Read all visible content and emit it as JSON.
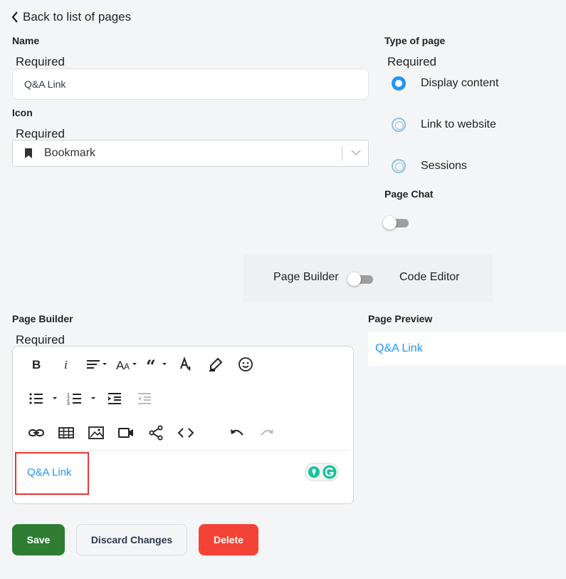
{
  "nav": {
    "back_label": "Back to list of pages"
  },
  "name_field": {
    "label": "Name",
    "required": "Required",
    "value": "Q&A Link"
  },
  "icon_field": {
    "label": "Icon",
    "required": "Required",
    "value": "Bookmark",
    "icon": "bookmark-icon"
  },
  "type_of_page": {
    "label": "Type of page",
    "required": "Required",
    "options": [
      {
        "label": "Display content",
        "selected": true
      },
      {
        "label": "Link to website",
        "selected": false
      },
      {
        "label": "Sessions",
        "selected": false
      }
    ]
  },
  "page_chat": {
    "label": "Page Chat",
    "enabled": false
  },
  "mode_switch": {
    "left_label": "Page Builder",
    "right_label": "Code Editor",
    "code_editor_on": false
  },
  "page_builder": {
    "label": "Page Builder",
    "required": "Required",
    "content": "Q&A Link",
    "toolbar_icons": [
      "bold-icon",
      "italic-icon",
      "align-icon",
      "font-size-icon",
      "quote-icon",
      "text-color-icon",
      "highlight-icon",
      "emoji-icon",
      "bullet-list-icon",
      "numbered-list-icon",
      "indent-icon",
      "outdent-icon",
      "link-icon",
      "table-icon",
      "image-icon",
      "video-icon",
      "share-icon",
      "code-icon",
      "undo-icon",
      "redo-icon"
    ]
  },
  "preview": {
    "label": "Page Preview",
    "content": "Q&A Link"
  },
  "actions": {
    "save": "Save",
    "discard": "Discard Changes",
    "delete": "Delete"
  },
  "colors": {
    "accent": "#2196f3",
    "save": "#2e7d32",
    "delete": "#f44336",
    "highlight": "#e53935"
  }
}
